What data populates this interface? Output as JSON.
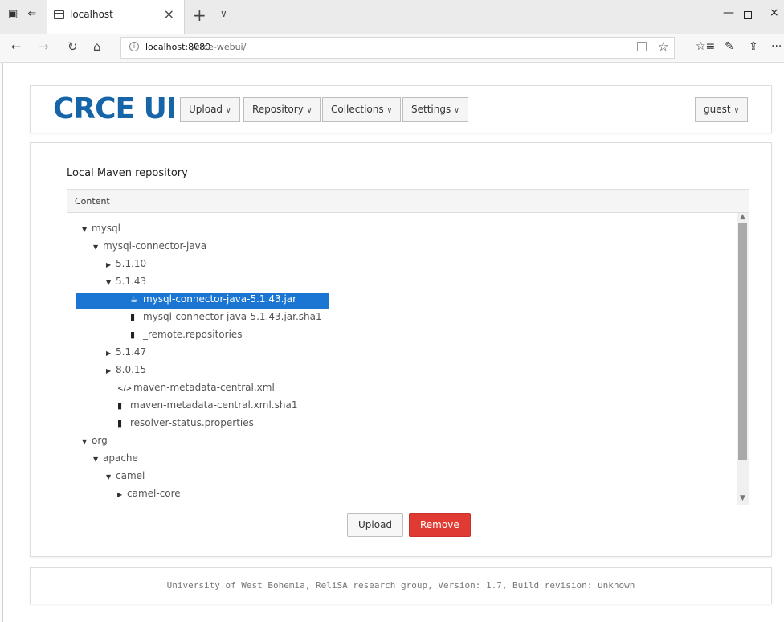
{
  "browser": {
    "tab_title": "localhost",
    "tab_close": "×",
    "new_tab": "+",
    "tab_list": "∨",
    "win_min": "—",
    "win_close": "×",
    "back": "←",
    "forward": "→",
    "refresh": "↻",
    "home": "⌂",
    "address_host": "localhost:8080",
    "address_path": "/crce-webui/",
    "info_glyph": "i",
    "star": "☆",
    "tools": [
      "☆≡",
      "✎",
      "⇪",
      "···"
    ]
  },
  "app": {
    "logo": "CRCE UI",
    "menus": [
      {
        "label": "Upload"
      },
      {
        "label": "Repository"
      },
      {
        "label": "Collections"
      },
      {
        "label": "Settings"
      }
    ],
    "caret": "∨",
    "user": "guest"
  },
  "content": {
    "section_title": "Local Maven repository",
    "tree_header": "Content",
    "tree": [
      {
        "label": "mysql",
        "toggle": "▼",
        "icon": ""
      },
      {
        "label": "mysql-connector-java",
        "toggle": "▼",
        "icon": ""
      },
      {
        "label": "5.1.10",
        "toggle": "▶",
        "icon": ""
      },
      {
        "label": "5.1.43",
        "toggle": "▼",
        "icon": ""
      },
      {
        "label": "mysql-connector-java-5.1.43.jar",
        "toggle": "",
        "icon": "☕"
      },
      {
        "label": "mysql-connector-java-5.1.43.jar.sha1",
        "toggle": "",
        "icon": "▮"
      },
      {
        "label": "_remote.repositories",
        "toggle": "",
        "icon": "▮"
      },
      {
        "label": "5.1.47",
        "toggle": "▶",
        "icon": ""
      },
      {
        "label": "8.0.15",
        "toggle": "▶",
        "icon": ""
      },
      {
        "label": "maven-metadata-central.xml",
        "toggle": "",
        "icon": "</>"
      },
      {
        "label": "maven-metadata-central.xml.sha1",
        "toggle": "",
        "icon": "▮"
      },
      {
        "label": "resolver-status.properties",
        "toggle": "",
        "icon": "▮"
      },
      {
        "label": "org",
        "toggle": "▼",
        "icon": ""
      },
      {
        "label": "apache",
        "toggle": "▼",
        "icon": ""
      },
      {
        "label": "camel",
        "toggle": "▼",
        "icon": ""
      },
      {
        "label": "camel-core",
        "toggle": "▶",
        "icon": ""
      }
    ],
    "scroll_up": "▲",
    "scroll_down": "▼",
    "upload_button": "Upload",
    "remove_button": "Remove"
  },
  "footer": {
    "text": "University of West Bohemia, ReliSA research group, Version: 1.7, Build revision: unknown"
  }
}
